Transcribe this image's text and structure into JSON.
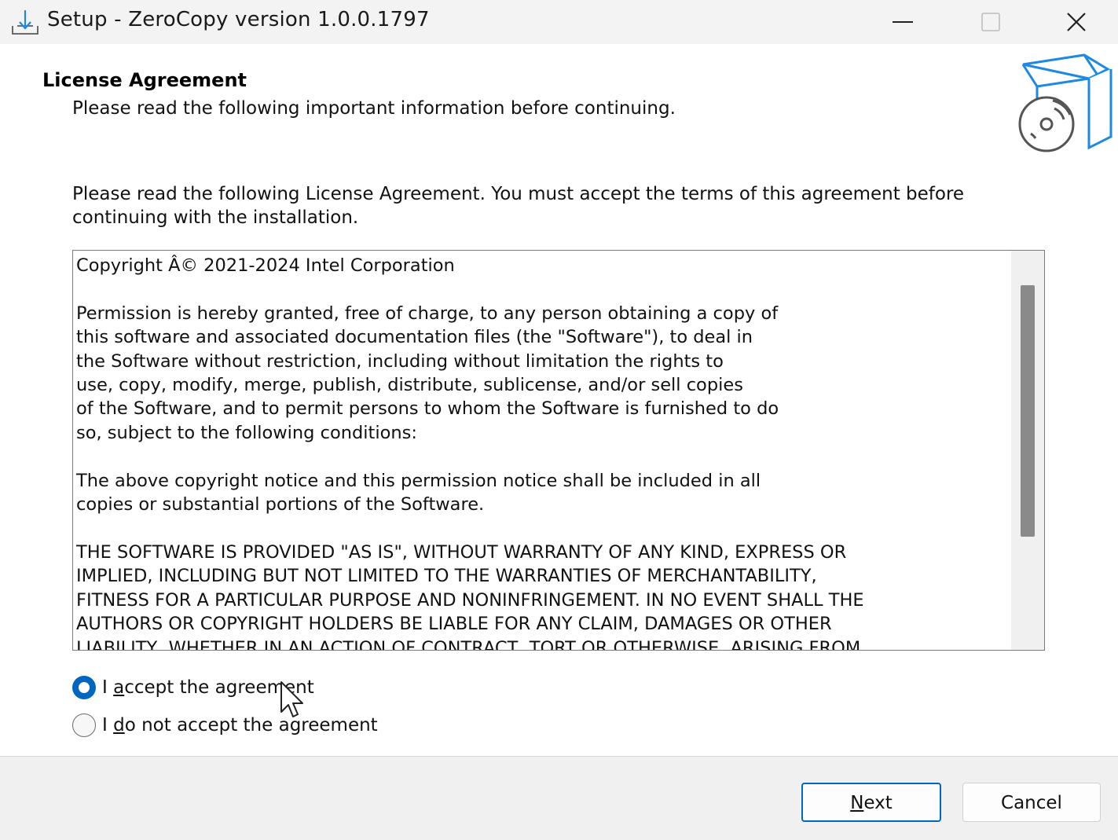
{
  "window": {
    "title": "Setup - ZeroCopy version 1.0.0.1797"
  },
  "header": {
    "heading": "License Agreement",
    "subheading": "Please read the following important information before continuing."
  },
  "main": {
    "intro": "Please read the following License Agreement. You must accept the terms of this agreement before continuing with the installation.",
    "license_text": "Copyright Â© 2021-2024 Intel Corporation\n\nPermission is hereby granted, free of charge, to any person obtaining a copy of\nthis software and associated documentation files (the \"Software\"), to deal in\nthe Software without restriction, including without limitation the rights to\nuse, copy, modify, merge, publish, distribute, sublicense, and/or sell copies\nof the Software, and to permit persons to whom the Software is furnished to do\nso, subject to the following conditions:\n\nThe above copyright notice and this permission notice shall be included in all\ncopies or substantial portions of the Software.\n\nTHE SOFTWARE IS PROVIDED \"AS IS\", WITHOUT WARRANTY OF ANY KIND, EXPRESS OR\nIMPLIED, INCLUDING BUT NOT LIMITED TO THE WARRANTIES OF MERCHANTABILITY,\nFITNESS FOR A PARTICULAR PURPOSE AND NONINFRINGEMENT. IN NO EVENT SHALL THE\nAUTHORS OR COPYRIGHT HOLDERS BE LIABLE FOR ANY CLAIM, DAMAGES OR OTHER\nLIABILITY, WHETHER IN AN ACTION OF CONTRACT, TORT OR OTHERWISE, ARISING FROM",
    "options": [
      {
        "pre": "I ",
        "accel": "a",
        "post": "ccept the agreement",
        "checked": true
      },
      {
        "pre": "I ",
        "accel": "d",
        "post": "o not accept the agreement",
        "checked": false
      }
    ]
  },
  "footer": {
    "next": {
      "accel": "N",
      "rest": "ext"
    },
    "cancel": "Cancel"
  },
  "colors": {
    "accent": "#0067c0",
    "graphic": "#1e88e5"
  },
  "icons": [
    "setup-app-icon",
    "minimize-icon",
    "maximize-icon",
    "close-icon",
    "software-box-disc-icon",
    "mouse-cursor-icon"
  ]
}
